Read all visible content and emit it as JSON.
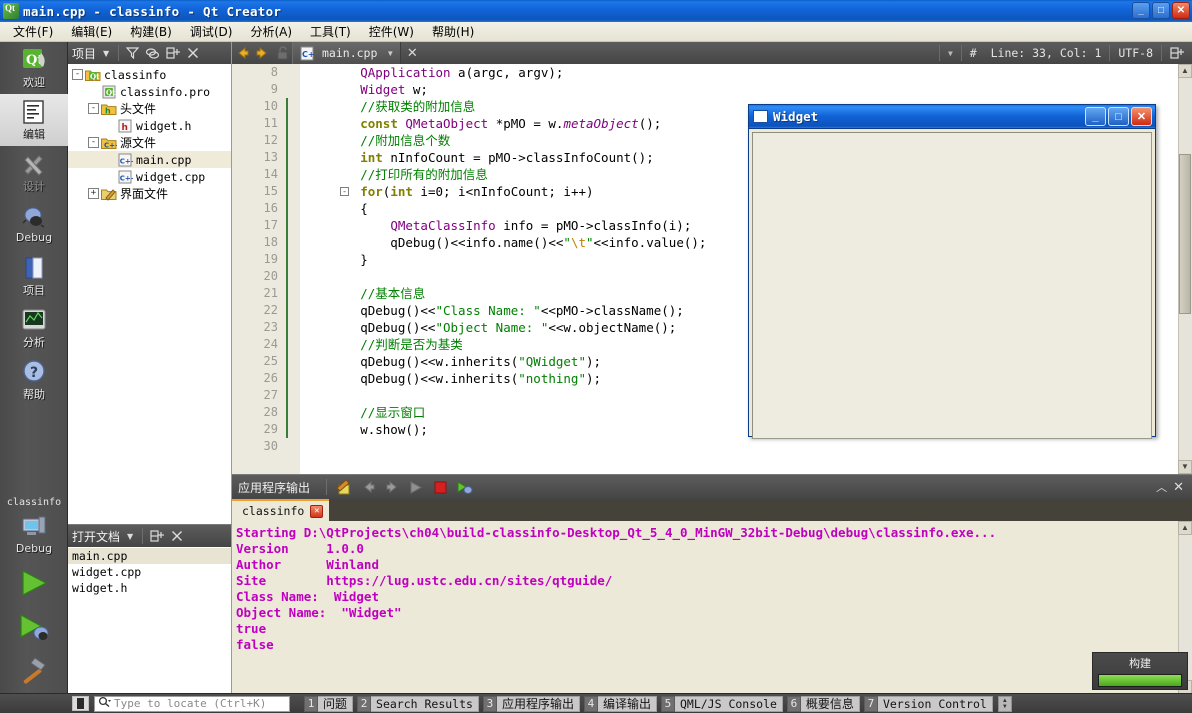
{
  "window": {
    "title": "main.cpp - classinfo - Qt Creator",
    "icon": "qt-logo-icon",
    "minimize": "_",
    "maximize": "□",
    "close": "✕"
  },
  "menubar": {
    "items": [
      {
        "label": "文件(F)",
        "name": "menu-file"
      },
      {
        "label": "编辑(E)",
        "name": "menu-edit"
      },
      {
        "label": "构建(B)",
        "name": "menu-build"
      },
      {
        "label": "调试(D)",
        "name": "menu-debug"
      },
      {
        "label": "分析(A)",
        "name": "menu-analyze"
      },
      {
        "label": "工具(T)",
        "name": "menu-tools"
      },
      {
        "label": "控件(W)",
        "name": "menu-window"
      },
      {
        "label": "帮助(H)",
        "name": "menu-help"
      }
    ]
  },
  "modebar": {
    "modes": [
      {
        "label": "欢迎",
        "icon": "qt-welcome-icon"
      },
      {
        "label": "编辑",
        "icon": "document-edit-icon"
      },
      {
        "label": "设计",
        "icon": "design-tools-icon"
      },
      {
        "label": "Debug",
        "icon": "bug-icon"
      },
      {
        "label": "项目",
        "icon": "folder-projects-icon"
      },
      {
        "label": "分析",
        "icon": "analyzer-chart-icon"
      },
      {
        "label": "帮助",
        "icon": "question-mark-icon"
      }
    ],
    "kit_name": "classinfo",
    "kit_mode": "Debug",
    "run_icon": "run-green-arrow-icon",
    "debug_icon": "run-debug-icon",
    "build_icon": "hammer-icon"
  },
  "navpanel": {
    "title": "项目",
    "dropdown_icon": "chevron-down-icon",
    "toolbar_icons": [
      "filter-icon",
      "link-sync-icon",
      "split-add-icon",
      "close-icon"
    ],
    "tree": [
      {
        "label": "classinfo",
        "depth": 0,
        "expander": "-",
        "icon": "qt-project-folder-icon",
        "cn": false,
        "selected": false
      },
      {
        "label": "classinfo.pro",
        "depth": 1,
        "expander": "",
        "icon": "qt-pro-file-icon",
        "cn": false,
        "selected": false
      },
      {
        "label": "头文件",
        "depth": 1,
        "expander": "-",
        "icon": "folder-headers-icon",
        "cn": true,
        "selected": false
      },
      {
        "label": "widget.h",
        "depth": 2,
        "expander": "",
        "icon": "h-file-icon",
        "cn": false,
        "selected": false
      },
      {
        "label": "源文件",
        "depth": 1,
        "expander": "-",
        "icon": "folder-sources-icon",
        "cn": true,
        "selected": false
      },
      {
        "label": "main.cpp",
        "depth": 2,
        "expander": "",
        "icon": "cpp-file-icon",
        "cn": false,
        "selected": true
      },
      {
        "label": "widget.cpp",
        "depth": 2,
        "expander": "",
        "icon": "cpp-file-icon",
        "cn": false,
        "selected": false
      },
      {
        "label": "界面文件",
        "depth": 1,
        "expander": "+",
        "icon": "folder-forms-icon",
        "cn": true,
        "selected": false
      }
    ]
  },
  "docpanel": {
    "title": "打开文档",
    "dropdown_icon": "chevron-down-icon",
    "toolbar_icons": [
      "split-add-icon",
      "close-icon"
    ],
    "documents": [
      {
        "label": "main.cpp",
        "selected": true
      },
      {
        "label": "widget.cpp",
        "selected": false
      },
      {
        "label": "widget.h",
        "selected": false
      }
    ]
  },
  "editor": {
    "toolbar": {
      "back_icon": "arrow-back-icon",
      "forward_icon": "arrow-forward-icon",
      "lock_icon": "unlocked-padlock-icon",
      "file_icon": "cpp-file-icon",
      "filename": "main.cpp",
      "file_dropdown_icon": "chevron-down-icon",
      "close_icon": "close-icon",
      "symbol_dropdown_icon": "chevron-down-icon",
      "line_col_icon": "#",
      "line_col": "Line: 33, Col: 1",
      "encoding": "UTF-8",
      "split_icon": "split-add-icon"
    },
    "first_line_number": 8,
    "lines": [
      {
        "n": 8,
        "fold": "",
        "bar": false,
        "tokens": [
          {
            "t": "        ",
            "c": ""
          },
          {
            "t": "QApplication",
            "c": "t"
          },
          {
            "t": " a(argc, argv);",
            "c": ""
          }
        ]
      },
      {
        "n": 9,
        "fold": "",
        "bar": false,
        "tokens": [
          {
            "t": "        ",
            "c": ""
          },
          {
            "t": "Widget",
            "c": "t"
          },
          {
            "t": " w;",
            "c": ""
          }
        ]
      },
      {
        "n": 10,
        "fold": "",
        "bar": true,
        "tokens": [
          {
            "t": "        ",
            "c": ""
          },
          {
            "t": "//获取类的附加信息",
            "c": "c"
          }
        ]
      },
      {
        "n": 11,
        "fold": "",
        "bar": true,
        "tokens": [
          {
            "t": "        ",
            "c": ""
          },
          {
            "t": "const",
            "c": "k"
          },
          {
            "t": " ",
            "c": ""
          },
          {
            "t": "QMetaObject",
            "c": "t"
          },
          {
            "t": " *pMO = w.",
            "c": ""
          },
          {
            "t": "metaObject",
            "c": "t2"
          },
          {
            "t": "();",
            "c": ""
          }
        ]
      },
      {
        "n": 12,
        "fold": "",
        "bar": true,
        "tokens": [
          {
            "t": "        ",
            "c": ""
          },
          {
            "t": "//附加信息个数",
            "c": "c"
          }
        ]
      },
      {
        "n": 13,
        "fold": "",
        "bar": true,
        "tokens": [
          {
            "t": "        ",
            "c": ""
          },
          {
            "t": "int",
            "c": "k"
          },
          {
            "t": " nInfoCount = pMO->classInfoCount();",
            "c": ""
          }
        ]
      },
      {
        "n": 14,
        "fold": "",
        "bar": true,
        "tokens": [
          {
            "t": "        ",
            "c": ""
          },
          {
            "t": "//打印所有的附加信息",
            "c": "c"
          }
        ]
      },
      {
        "n": 15,
        "fold": "-",
        "bar": true,
        "tokens": [
          {
            "t": "        ",
            "c": ""
          },
          {
            "t": "for",
            "c": "k"
          },
          {
            "t": "(",
            "c": ""
          },
          {
            "t": "int",
            "c": "k"
          },
          {
            "t": " i=0; i<nInfoCount; i++)",
            "c": ""
          }
        ]
      },
      {
        "n": 16,
        "fold": "",
        "bar": true,
        "tokens": [
          {
            "t": "        {",
            "c": ""
          }
        ]
      },
      {
        "n": 17,
        "fold": "",
        "bar": true,
        "tokens": [
          {
            "t": "            ",
            "c": ""
          },
          {
            "t": "QMetaClassInfo",
            "c": "t"
          },
          {
            "t": " info = pMO->classInfo(i);",
            "c": ""
          }
        ]
      },
      {
        "n": 18,
        "fold": "",
        "bar": true,
        "tokens": [
          {
            "t": "            qDebug()<<info.name()<<",
            "c": ""
          },
          {
            "t": "\"",
            "c": "s"
          },
          {
            "t": "\\t",
            "c": "esc"
          },
          {
            "t": "\"",
            "c": "s"
          },
          {
            "t": "<<info.value();",
            "c": ""
          }
        ]
      },
      {
        "n": 19,
        "fold": "",
        "bar": true,
        "tokens": [
          {
            "t": "        }",
            "c": ""
          }
        ]
      },
      {
        "n": 20,
        "fold": "",
        "bar": true,
        "tokens": [
          {
            "t": "",
            "c": ""
          }
        ]
      },
      {
        "n": 21,
        "fold": "",
        "bar": true,
        "tokens": [
          {
            "t": "        ",
            "c": ""
          },
          {
            "t": "//基本信息",
            "c": "c"
          }
        ]
      },
      {
        "n": 22,
        "fold": "",
        "bar": true,
        "tokens": [
          {
            "t": "        qDebug()<<",
            "c": ""
          },
          {
            "t": "\"Class Name: \"",
            "c": "s"
          },
          {
            "t": "<<pMO->className();",
            "c": ""
          }
        ]
      },
      {
        "n": 23,
        "fold": "",
        "bar": true,
        "tokens": [
          {
            "t": "        qDebug()<<",
            "c": ""
          },
          {
            "t": "\"Object Name: \"",
            "c": "s"
          },
          {
            "t": "<<w.objectName();",
            "c": ""
          }
        ]
      },
      {
        "n": 24,
        "fold": "",
        "bar": true,
        "tokens": [
          {
            "t": "        ",
            "c": ""
          },
          {
            "t": "//判断是否为基类",
            "c": "c"
          }
        ]
      },
      {
        "n": 25,
        "fold": "",
        "bar": true,
        "tokens": [
          {
            "t": "        qDebug()<<w.inherits(",
            "c": ""
          },
          {
            "t": "\"QWidget\"",
            "c": "s"
          },
          {
            "t": ");",
            "c": ""
          }
        ]
      },
      {
        "n": 26,
        "fold": "",
        "bar": true,
        "tokens": [
          {
            "t": "        qDebug()<<w.inherits(",
            "c": ""
          },
          {
            "t": "\"nothing\"",
            "c": "s"
          },
          {
            "t": ");",
            "c": ""
          }
        ]
      },
      {
        "n": 27,
        "fold": "",
        "bar": true,
        "tokens": [
          {
            "t": "",
            "c": ""
          }
        ]
      },
      {
        "n": 28,
        "fold": "",
        "bar": true,
        "tokens": [
          {
            "t": "        ",
            "c": ""
          },
          {
            "t": "//显示窗口",
            "c": "c"
          }
        ]
      },
      {
        "n": 29,
        "fold": "",
        "bar": true,
        "tokens": [
          {
            "t": "        w.show();",
            "c": ""
          }
        ]
      },
      {
        "n": 30,
        "fold": "",
        "bar": false,
        "tokens": [
          {
            "t": "",
            "c": ""
          }
        ]
      }
    ]
  },
  "widget_window": {
    "title": "Widget",
    "icon": "window-icon",
    "minimize": "_",
    "maximize": "□",
    "close": "✕"
  },
  "output": {
    "title": "应用程序输出",
    "toolbar_icons": [
      "clear-pencil-icon",
      "prev-arrow-icon",
      "next-arrow-icon",
      "run-arrow-icon",
      "stop-square-icon",
      "rerun-debug-icon"
    ],
    "collapse_icon": "chevron-up-icon",
    "close_icon": "close-icon",
    "tab": {
      "label": "classinfo",
      "close_icon": "close-icon"
    },
    "lines": [
      "Starting D:\\QtProjects\\ch04\\build-classinfo-Desktop_Qt_5_4_0_MinGW_32bit-Debug\\debug\\classinfo.exe...",
      "Version     1.0.0",
      "Author      Winland",
      "Site        https://lug.ustc.edu.cn/sites/qtguide/",
      "Class Name:  Widget",
      "Object Name:  \"Widget\"",
      "true",
      "false"
    ],
    "text_color": "#c000c0"
  },
  "build_progress": {
    "label": "构建",
    "percent": 100,
    "bar_color": "#4aa81e"
  },
  "statusbar": {
    "sidebar_toggle_icon": "sidebar-toggle-icon",
    "locator": {
      "icon": "search-icon",
      "placeholder": "Type to locate (Ctrl+K)",
      "value": ""
    },
    "panes": [
      {
        "num": "1",
        "label": "问题",
        "cn": true
      },
      {
        "num": "2",
        "label": "Search Results",
        "cn": false
      },
      {
        "num": "3",
        "label": "应用程序输出",
        "cn": true
      },
      {
        "num": "4",
        "label": "编译输出",
        "cn": true
      },
      {
        "num": "5",
        "label": "QML/JS Console",
        "cn": false
      },
      {
        "num": "6",
        "label": "概要信息",
        "cn": true
      },
      {
        "num": "7",
        "label": "Version Control",
        "cn": false
      }
    ],
    "spinner_icon": "updown-spinner-icon"
  }
}
